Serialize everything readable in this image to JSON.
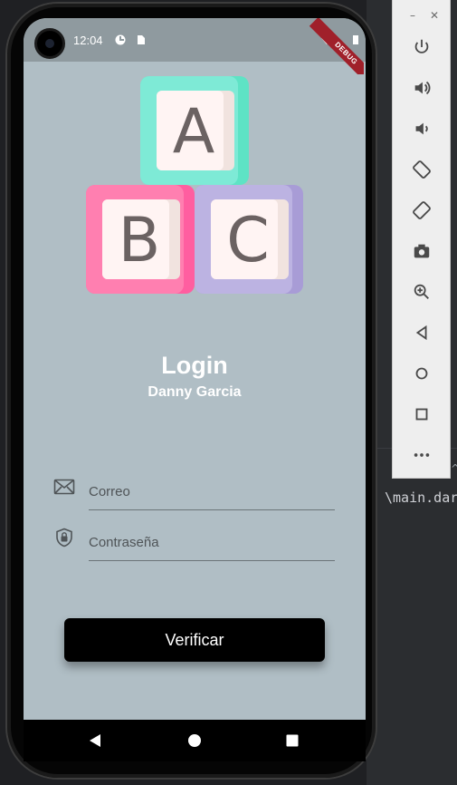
{
  "status_bar": {
    "time": "12:04",
    "debug_banner": "DEBUG"
  },
  "login": {
    "title": "Login",
    "subtitle": "Danny Garcia"
  },
  "blocks": {
    "a": "A",
    "b": "B",
    "c": "C"
  },
  "fields": {
    "email": {
      "placeholder": "Correo",
      "value": ""
    },
    "password": {
      "placeholder": "Contraseña",
      "value": ""
    }
  },
  "verify_button": {
    "label": "Verificar"
  },
  "ide": {
    "tab_text": "\\main.dar"
  },
  "icons": {
    "email": "mail-icon",
    "password": "lock-shield-icon",
    "nav_back": "back-triangle-icon",
    "nav_home": "home-circle-icon",
    "nav_recent": "recent-square-icon"
  },
  "colors": {
    "screen_bg": "#b0bec5",
    "block_a": "#6ee6cf",
    "block_b": "#ff6fa6",
    "block_c": "#b3a8dd",
    "button_bg": "#000000"
  }
}
